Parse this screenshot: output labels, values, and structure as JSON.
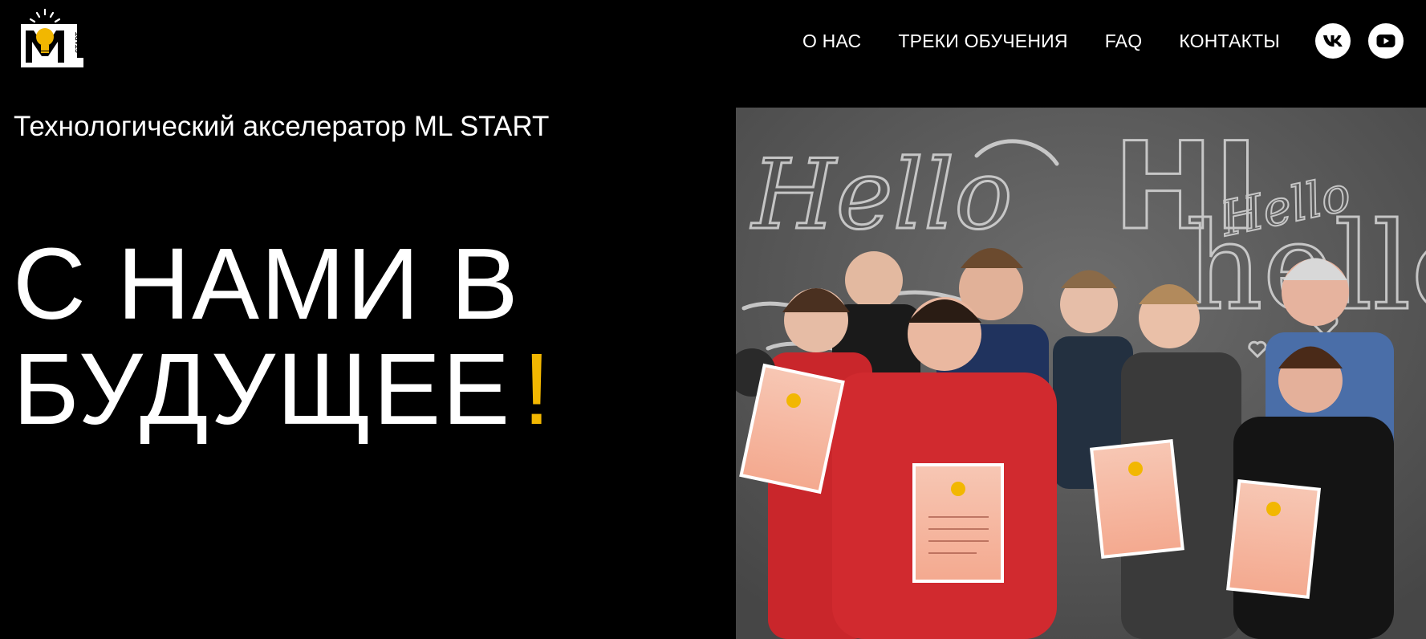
{
  "header": {
    "logo": {
      "icon": "lightbulb-logo-icon",
      "letters": "ML",
      "small_text": "START",
      "accent": "#f2b701"
    },
    "nav": [
      {
        "label": "О НАС"
      },
      {
        "label": "ТРЕКИ ОБУЧЕНИЯ"
      },
      {
        "label": "FAQ"
      },
      {
        "label": "КОНТАКТЫ"
      }
    ],
    "social": [
      {
        "icon": "vk-icon"
      },
      {
        "icon": "youtube-icon"
      }
    ]
  },
  "hero": {
    "tagline": "Технологический акселератор ML START",
    "headline_line1": "С НАМИ В",
    "headline_line2": "БУДУЩЕЕ",
    "headline_exclamation": "!",
    "accent_color": "#f2b701"
  },
  "photo": {
    "chalkboard_words": [
      "Hello",
      "HI",
      "Hello",
      "hello"
    ]
  },
  "colors": {
    "background": "#000000",
    "text": "#ffffff",
    "accent": "#f2b701"
  }
}
